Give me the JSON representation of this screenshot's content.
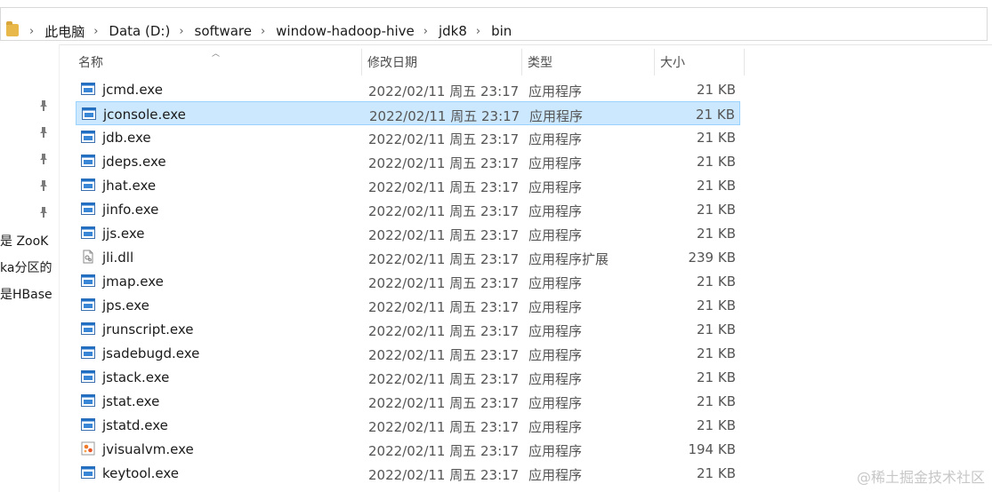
{
  "address_bar": {
    "crumbs": [
      "此电脑",
      "Data (D:)",
      "software",
      "window-hadoop-hive",
      "jdk8",
      "bin"
    ],
    "separator": "›"
  },
  "nav": {
    "texts": [
      "是 ZooK",
      "ka分区的",
      "是HBase"
    ]
  },
  "columns": {
    "name": "名称",
    "date": "修改日期",
    "type": "类型",
    "size": "大小"
  },
  "files": [
    {
      "name": "jcmd.exe",
      "date": "2022/02/11 周五 23:17",
      "type": "应用程序",
      "size": "21 KB",
      "icon": "exe-icon"
    },
    {
      "name": "jconsole.exe",
      "date": "2022/02/11 周五 23:17",
      "type": "应用程序",
      "size": "21 KB",
      "icon": "exe-icon",
      "selected": true
    },
    {
      "name": "jdb.exe",
      "date": "2022/02/11 周五 23:17",
      "type": "应用程序",
      "size": "21 KB",
      "icon": "exe-icon"
    },
    {
      "name": "jdeps.exe",
      "date": "2022/02/11 周五 23:17",
      "type": "应用程序",
      "size": "21 KB",
      "icon": "exe-icon"
    },
    {
      "name": "jhat.exe",
      "date": "2022/02/11 周五 23:17",
      "type": "应用程序",
      "size": "21 KB",
      "icon": "exe-icon"
    },
    {
      "name": "jinfo.exe",
      "date": "2022/02/11 周五 23:17",
      "type": "应用程序",
      "size": "21 KB",
      "icon": "exe-icon"
    },
    {
      "name": "jjs.exe",
      "date": "2022/02/11 周五 23:17",
      "type": "应用程序",
      "size": "21 KB",
      "icon": "exe-icon"
    },
    {
      "name": "jli.dll",
      "date": "2022/02/11 周五 23:17",
      "type": "应用程序扩展",
      "size": "239 KB",
      "icon": "dll-icon"
    },
    {
      "name": "jmap.exe",
      "date": "2022/02/11 周五 23:17",
      "type": "应用程序",
      "size": "21 KB",
      "icon": "exe-icon"
    },
    {
      "name": "jps.exe",
      "date": "2022/02/11 周五 23:17",
      "type": "应用程序",
      "size": "21 KB",
      "icon": "exe-icon"
    },
    {
      "name": "jrunscript.exe",
      "date": "2022/02/11 周五 23:17",
      "type": "应用程序",
      "size": "21 KB",
      "icon": "exe-icon"
    },
    {
      "name": "jsadebugd.exe",
      "date": "2022/02/11 周五 23:17",
      "type": "应用程序",
      "size": "21 KB",
      "icon": "exe-icon"
    },
    {
      "name": "jstack.exe",
      "date": "2022/02/11 周五 23:17",
      "type": "应用程序",
      "size": "21 KB",
      "icon": "exe-icon"
    },
    {
      "name": "jstat.exe",
      "date": "2022/02/11 周五 23:17",
      "type": "应用程序",
      "size": "21 KB",
      "icon": "exe-icon"
    },
    {
      "name": "jstatd.exe",
      "date": "2022/02/11 周五 23:17",
      "type": "应用程序",
      "size": "21 KB",
      "icon": "exe-icon"
    },
    {
      "name": "jvisualvm.exe",
      "date": "2022/02/11 周五 23:17",
      "type": "应用程序",
      "size": "194 KB",
      "icon": "jvisualvm-icon"
    },
    {
      "name": "keytool.exe",
      "date": "2022/02/11 周五 23:17",
      "type": "应用程序",
      "size": "21 KB",
      "icon": "exe-icon"
    }
  ],
  "watermark": "@稀土掘金技术社区",
  "colors": {
    "selection_bg": "#cce8ff",
    "selection_border": "#99d1ff",
    "exe_icon_blue": "#1f6fc5"
  }
}
